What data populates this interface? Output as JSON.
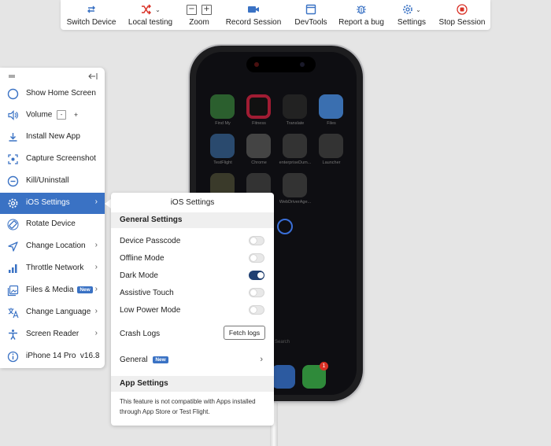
{
  "toolbar": {
    "switch_device": "Switch Device",
    "local_testing": "Local testing",
    "zoom": "Zoom",
    "zoom_minus": "−",
    "zoom_plus": "+",
    "record_session": "Record Session",
    "devtools": "DevTools",
    "report_bug": "Report a bug",
    "settings": "Settings",
    "stop_session": "Stop Session"
  },
  "menu": {
    "items": [
      {
        "label": "Show Home Screen",
        "icon": "circle-icon"
      },
      {
        "label": "Volume",
        "icon": "volume-icon"
      },
      {
        "label": "Install New App",
        "icon": "download-icon"
      },
      {
        "label": "Capture Screenshot",
        "icon": "screenshot-icon"
      },
      {
        "label": "Kill/Uninstall",
        "icon": "minus-circle-icon"
      },
      {
        "label": "iOS Settings",
        "icon": "gear-icon"
      },
      {
        "label": "Rotate Device",
        "icon": "rotate-icon"
      },
      {
        "label": "Change Location",
        "icon": "location-icon"
      },
      {
        "label": "Throttle Network",
        "icon": "signal-icon"
      },
      {
        "label": "Files & Media",
        "icon": "image-icon",
        "badge": "New"
      },
      {
        "label": "Change Language",
        "icon": "translate-icon"
      },
      {
        "label": "Screen Reader",
        "icon": "accessibility-icon"
      },
      {
        "label": "iPhone 14 Pro  v16.3",
        "icon": "info-icon"
      }
    ],
    "volume_minus": "-",
    "volume_plus": "+",
    "chevron": "›"
  },
  "ios_settings": {
    "title": "iOS Settings",
    "general_settings_header": "General Settings",
    "toggles": [
      {
        "label": "Device Passcode",
        "on": false
      },
      {
        "label": "Offline Mode",
        "on": false
      },
      {
        "label": "Dark Mode",
        "on": true
      },
      {
        "label": "Assistive Touch",
        "on": false
      },
      {
        "label": "Low Power Mode",
        "on": false
      }
    ],
    "crash_logs_label": "Crash Logs",
    "fetch_logs_button": "Fetch logs",
    "general_label": "General",
    "general_badge": "New",
    "app_settings_header": "App Settings",
    "app_settings_note": "This feature is not compatible with Apps installed through App Store or Test Flight."
  },
  "phone": {
    "apps": [
      "Find My",
      "Fitness",
      "Translate",
      "Files",
      "TestFlight",
      "Chrome",
      "enterpriseDum...",
      "Launcher",
      "",
      "",
      "WebDriverAge..."
    ],
    "search_hint": "Search",
    "messages_badge": "1"
  },
  "colors": {
    "accent": "#3a72c4",
    "toggle_on": "#1f3f72",
    "stop_red": "#d93025"
  }
}
